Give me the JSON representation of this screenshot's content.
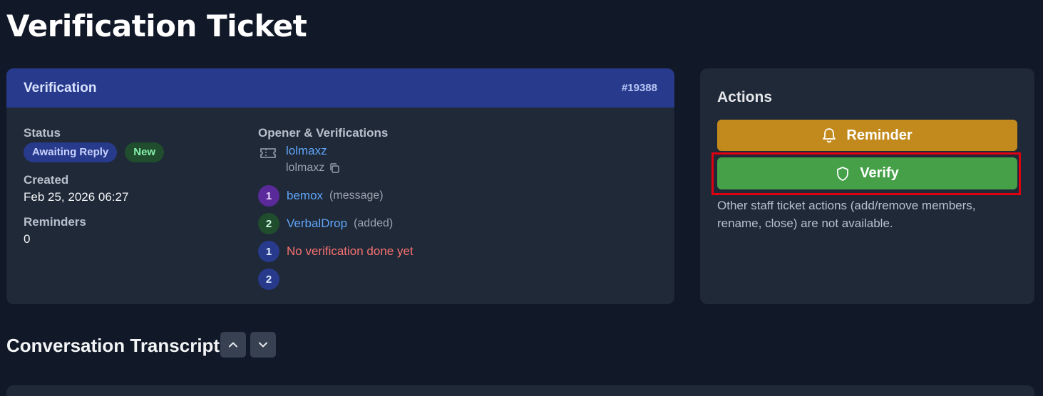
{
  "page": {
    "title": "Verification Ticket"
  },
  "ticket": {
    "header_title": "Verification",
    "number": "#19388",
    "status_label": "Status",
    "badges": [
      "Awaiting Reply",
      "New"
    ],
    "created_label": "Created",
    "created_value": "Feb 25, 2026 06:27",
    "reminders_label": "Reminders",
    "reminders_value": "0",
    "opener_label": "Opener & Verifications",
    "opener_name": "lolmaxz",
    "opener_username": "lolmaxz",
    "verifications": [
      {
        "num": "1",
        "name": "bemox",
        "note": "(message)"
      },
      {
        "num": "2",
        "name": "VerbalDrop",
        "note": "(added)"
      },
      {
        "num": "1",
        "text": "No verification done yet"
      },
      {
        "num": "2",
        "text": ""
      }
    ]
  },
  "actions": {
    "title": "Actions",
    "reminder_label": "Reminder",
    "verify_label": "Verify",
    "note": "Other staff ticket actions (add/remove members, rename, close) are not available."
  },
  "transcript": {
    "title": "Conversation Transcript"
  },
  "icons": {
    "bell": "bell-icon",
    "shield": "shield-icon",
    "ticket": "ticket-icon",
    "copy": "copy-icon",
    "up": "chevron-up-icon",
    "down": "chevron-down-icon"
  },
  "colors": {
    "background": "#111827",
    "card": "#1f2937",
    "header": "#283a8c",
    "reminder": "#c28a1c",
    "verify": "#45a048",
    "highlight": "#e00010",
    "link": "#60a5fa",
    "warning": "#f87171"
  }
}
